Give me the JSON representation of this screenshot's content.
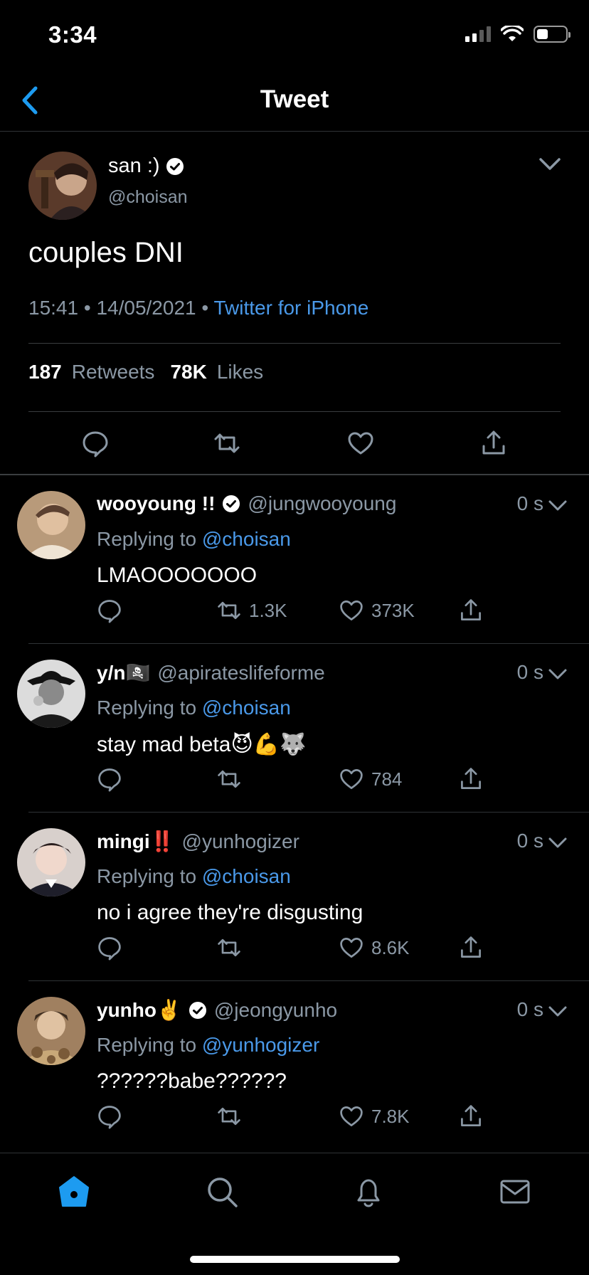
{
  "status_bar": {
    "time": "3:34",
    "battery_level": 0.4
  },
  "nav": {
    "title": "Tweet"
  },
  "main_tweet": {
    "author_name": "san :)",
    "handle": "@choisan",
    "verified": true,
    "text": "couples DNI",
    "time": "15:41",
    "date": "14/05/2021",
    "source": "Twitter for iPhone",
    "retweets_count": "187",
    "retweets_label": "Retweets",
    "likes_count": "78K",
    "likes_label": "Likes"
  },
  "replies": [
    {
      "name": "wooyoung !!",
      "verified": true,
      "handle": "@jungwooyoung",
      "time": "0 s",
      "replying_prefix": "Replying to",
      "replying_to": "@choisan",
      "text": "LMAOOOOOOO",
      "retweets": "1.3K",
      "likes": "373K"
    },
    {
      "name": "y/n🏴‍☠️",
      "verified": false,
      "handle": "@apirateslifeforme",
      "time": "0 s",
      "replying_prefix": "Replying to",
      "replying_to": "@choisan",
      "text": "stay mad beta😈💪🐺",
      "retweets": "",
      "likes": "784"
    },
    {
      "name": "mingi‼️",
      "verified": false,
      "handle": "@yunhogizer",
      "time": "0 s",
      "replying_prefix": "Replying to",
      "replying_to": "@choisan",
      "text": "no i agree they're disgusting",
      "retweets": "",
      "likes": "8.6K"
    },
    {
      "name": "yunho✌️",
      "verified": true,
      "handle": "@jeongyunho",
      "time": "0 s",
      "replying_prefix": "Replying to",
      "replying_to": "@yunhogizer",
      "text": "??????babe??????",
      "retweets": "",
      "likes": "7.8K"
    }
  ],
  "tabs": [
    {
      "icon": "home-icon",
      "active": true
    },
    {
      "icon": "search-icon",
      "active": false
    },
    {
      "icon": "bell-icon",
      "active": false
    },
    {
      "icon": "mail-icon",
      "active": false
    }
  ],
  "colors": {
    "accent": "#1d9bf0",
    "link": "#4a99e9",
    "muted": "#8b98a5",
    "background": "#000000"
  }
}
